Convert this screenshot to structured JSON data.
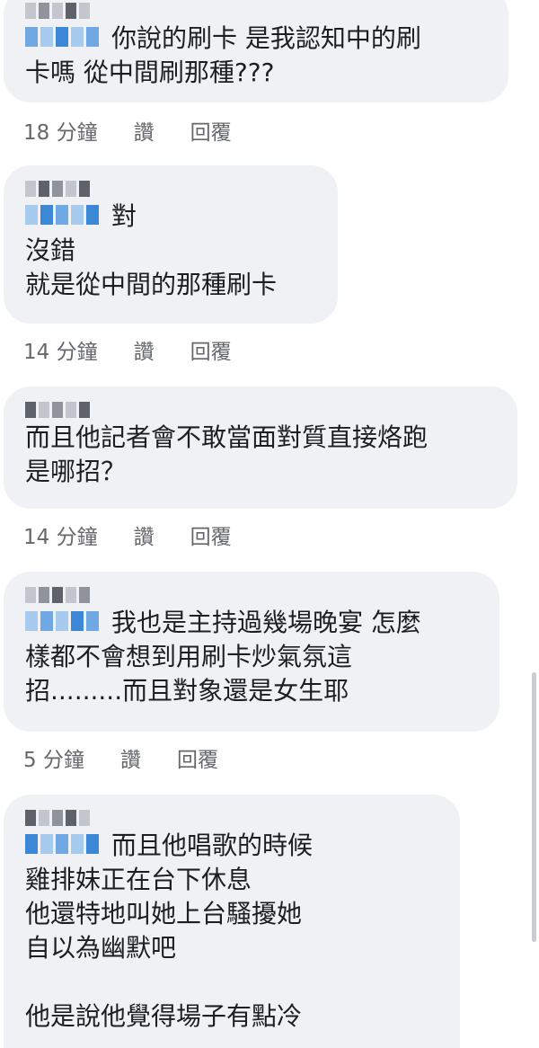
{
  "comments": [
    {
      "lines": [
        "你說的刷卡 是我認知中的刷",
        "卡嗎 從中間刷那種???"
      ],
      "time": "18 分鐘",
      "like": "讚",
      "reply": "回覆"
    },
    {
      "lines": [
        "對",
        "沒錯",
        "就是從中間的那種刷卡"
      ],
      "time": "14 分鐘",
      "like": "讚",
      "reply": "回覆"
    },
    {
      "lines": [
        "而且他記者會不敢當面對質直接烙跑",
        "是哪招？"
      ],
      "time": "14 分鐘",
      "like": "讚",
      "reply": "回覆"
    },
    {
      "lines": [
        "我也是主持過幾場晚宴 怎麼",
        "樣都不會想到用刷卡炒氣氛這",
        "招.........而且對象還是女生耶"
      ],
      "time": "5 分鐘",
      "like": "讚",
      "reply": "回覆"
    },
    {
      "lines": [
        "而且他唱歌的時候",
        "雞排妹正在台下休息",
        "他還特地叫她上台騷擾她",
        "自以為幽默吧",
        "",
        "他是說他覺得場子有點冷"
      ]
    }
  ]
}
